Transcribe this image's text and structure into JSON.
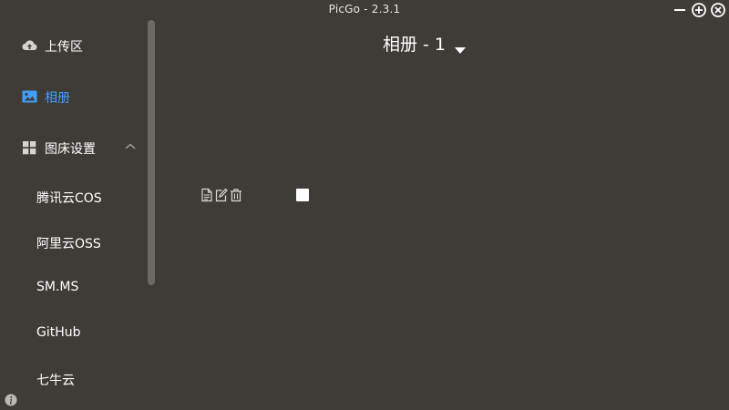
{
  "window": {
    "title": "PicGo - 2.3.1"
  },
  "sidebar": {
    "items": [
      {
        "label": "上传区",
        "icon": "cloud-upload-icon"
      },
      {
        "label": "相册",
        "icon": "image-icon",
        "active": true
      },
      {
        "label": "图床设置",
        "icon": "grid-icon",
        "expanded": true
      }
    ],
    "sub_items": [
      {
        "label": "腾讯云COS"
      },
      {
        "label": "阿里云OSS"
      },
      {
        "label": "SM.MS"
      },
      {
        "label": "GitHub"
      },
      {
        "label": "七牛云"
      }
    ]
  },
  "main": {
    "title": "相册 - 1",
    "actions": [
      "copy-icon",
      "edit-icon",
      "delete-icon"
    ],
    "checkbox_checked": false
  },
  "colors": {
    "background": "#3f3c37",
    "accent": "#409eff",
    "scrollbar": "#6b6966",
    "text": "#ffffff"
  }
}
